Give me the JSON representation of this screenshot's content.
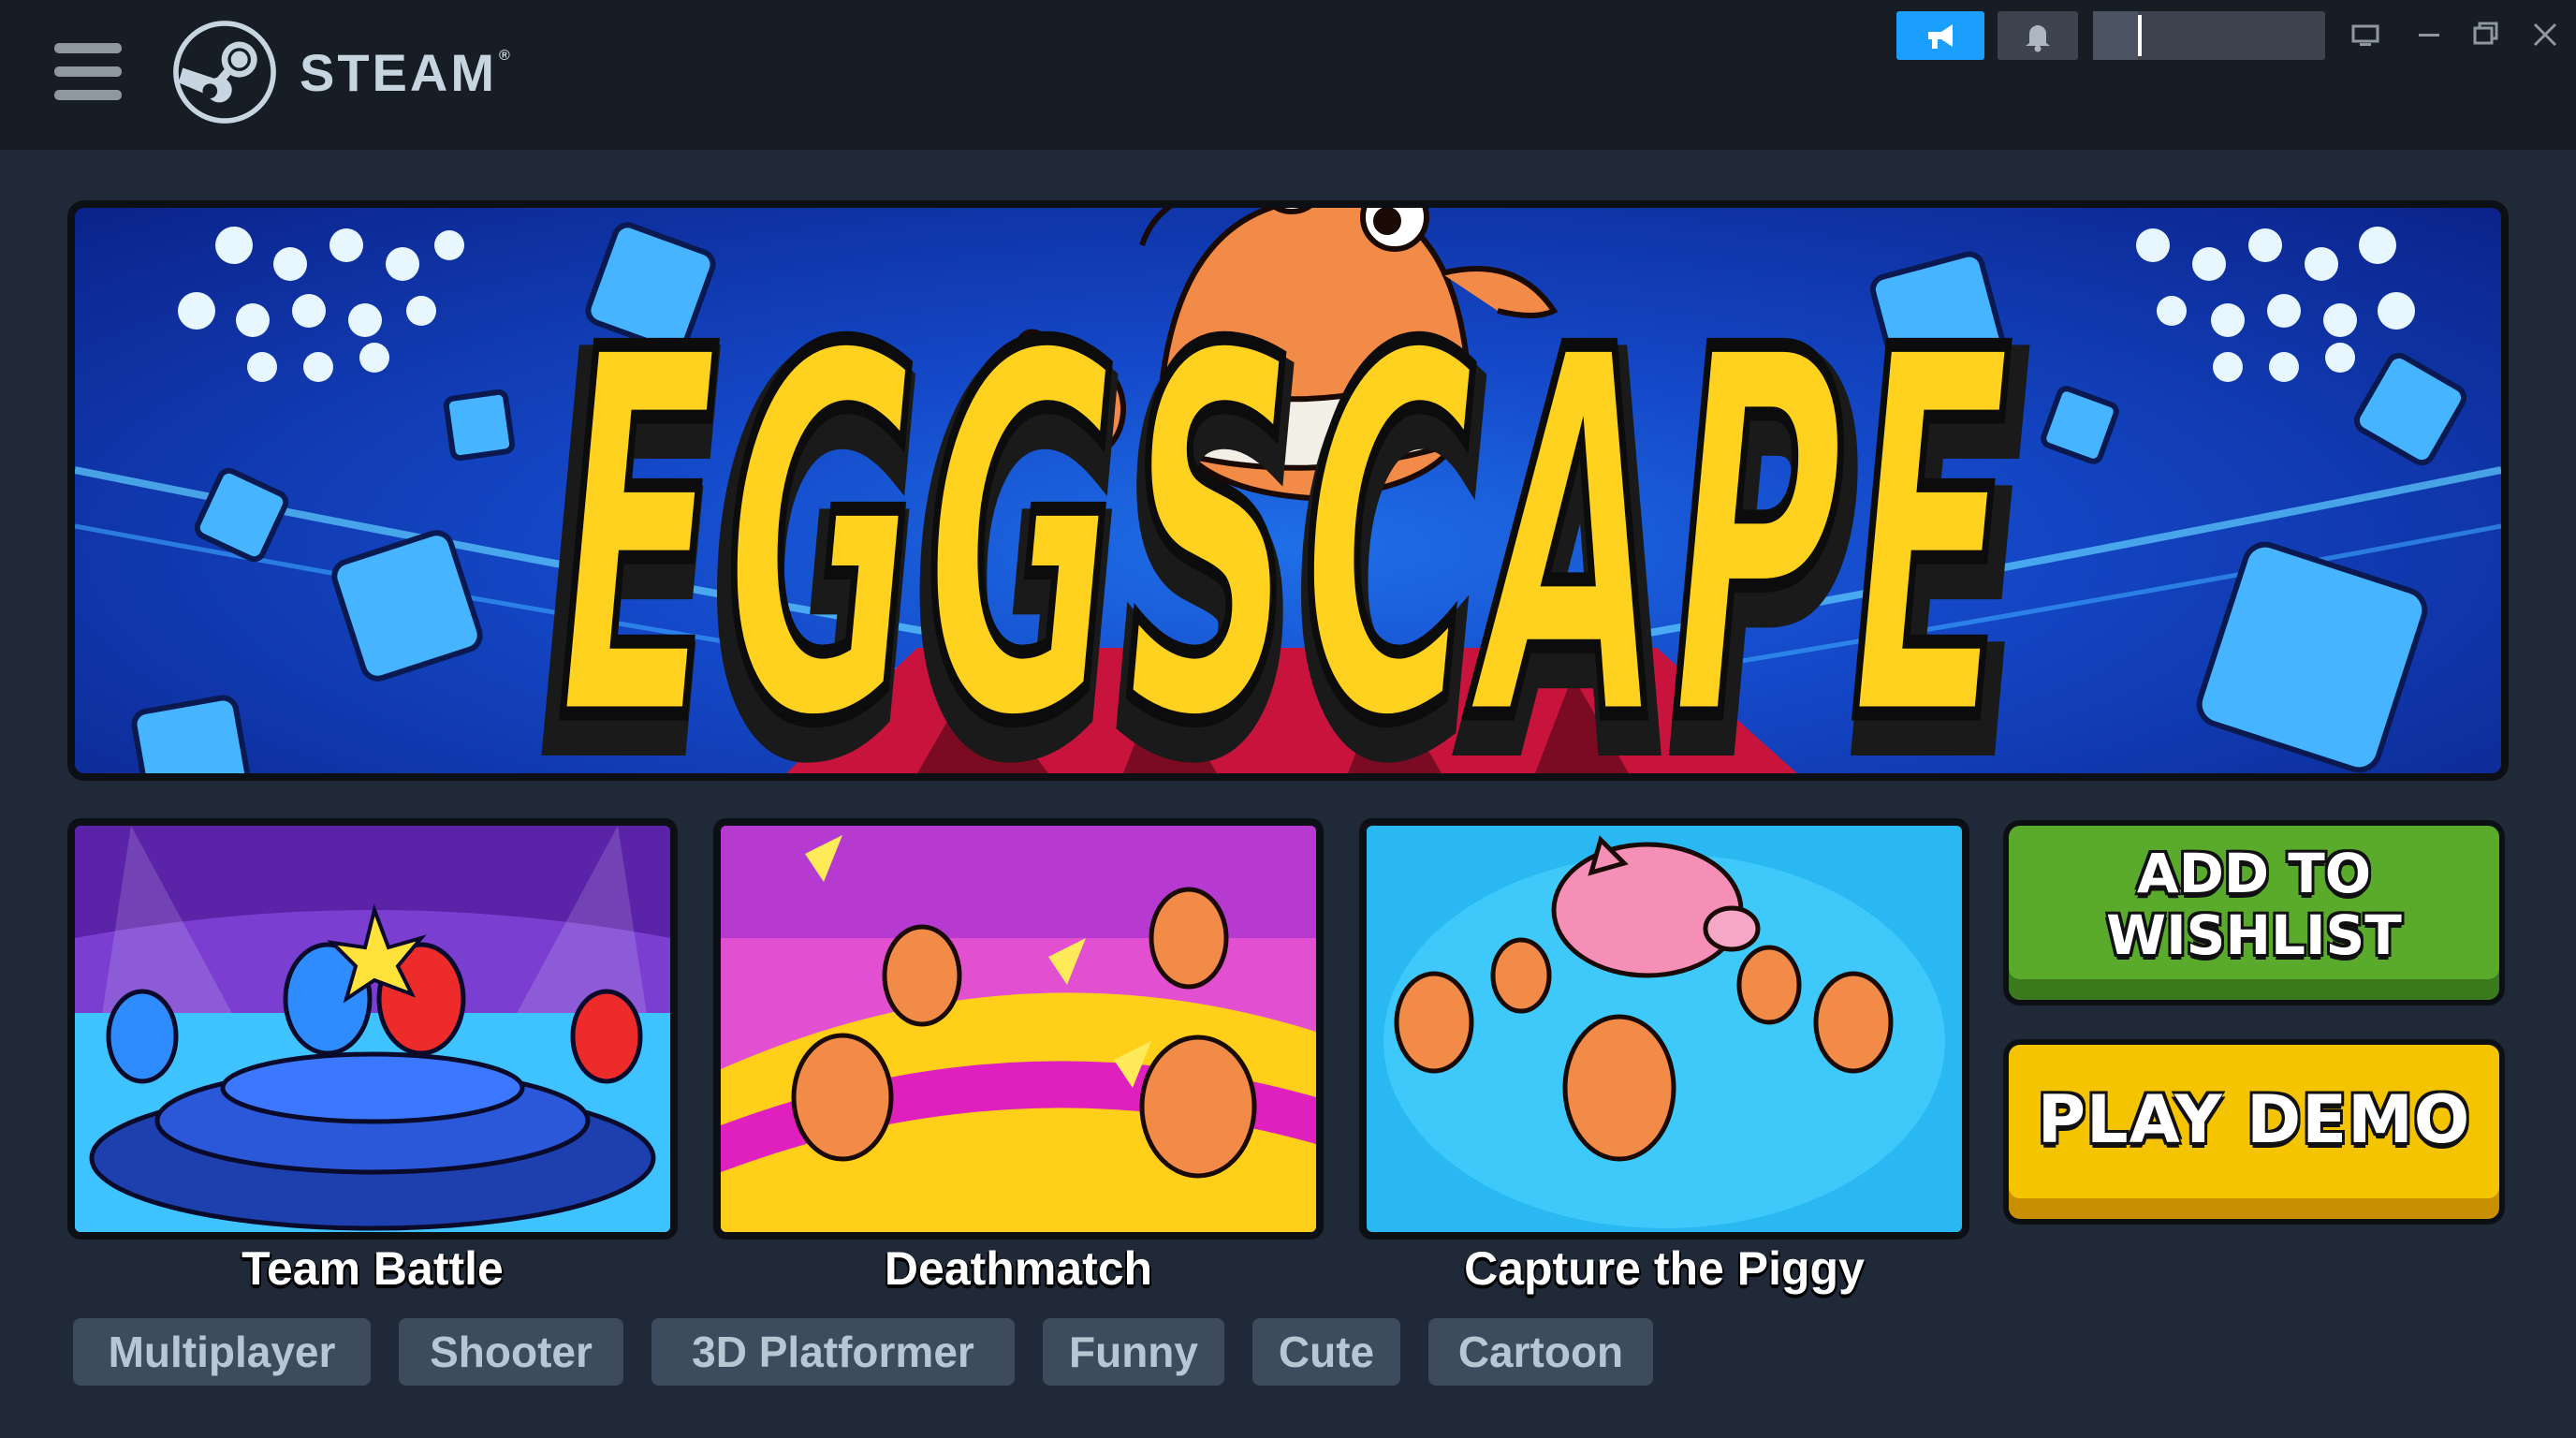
{
  "titlebar": {
    "brand": "STEAM",
    "icons": {
      "menu": "hamburger-menu-icon",
      "logo": "steam-logo-icon",
      "announcements": "megaphone-icon",
      "notifications": "bell-icon",
      "big_picture": "monitor-icon",
      "minimize": "minimize-icon",
      "maximize": "maximize-icon",
      "close": "close-icon"
    }
  },
  "hero": {
    "title": "EGGSCAPE"
  },
  "modes": [
    {
      "label": "Team Battle"
    },
    {
      "label": "Deathmatch"
    },
    {
      "label": "Capture the Piggy"
    }
  ],
  "actions": {
    "wishlist_line1": "ADD TO",
    "wishlist_line2": "WISHLIST",
    "demo": "PLAY DEMO"
  },
  "tags": [
    "Multiplayer",
    "Shooter",
    "3D Platformer",
    "Funny",
    "Cute",
    "Cartoon"
  ],
  "colors": {
    "titlebar_bg": "#171d25",
    "page_bg": "#1f2938",
    "accent_blue": "#1a9fff",
    "wishlist_green": "#5aaa2c",
    "demo_yellow": "#f5c400",
    "title_yellow": "#ffd21f",
    "tag_bg": "#3d4b5d"
  }
}
